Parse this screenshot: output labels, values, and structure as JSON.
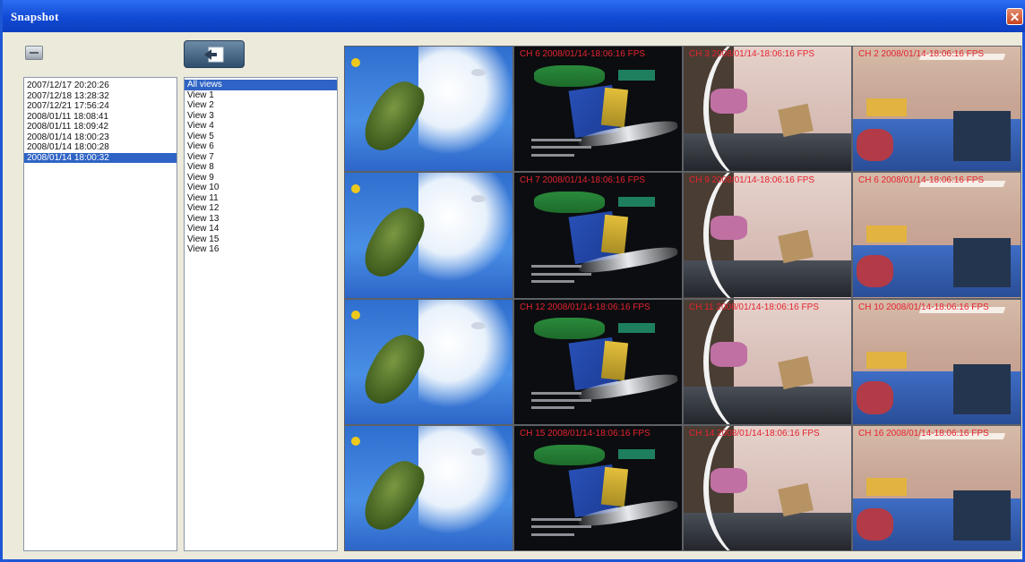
{
  "window": {
    "title": "Snapshot",
    "close_label": "✕"
  },
  "icons": {
    "minimize": "minus-icon",
    "export": "export-arrow-icon"
  },
  "colors": {
    "accent": "#2f63c5",
    "title_bar": "#1149d4",
    "overlay_text": "#e5232f"
  },
  "snapshot_list": {
    "items": [
      "2007/12/17 20:20:26",
      "2007/12/18 13:28:32",
      "2007/12/21 17:56:24",
      "2008/01/11 18:08:41",
      "2008/01/11 18:09:42",
      "2008/01/14 18:00:23",
      "2008/01/14 18:00:28",
      "2008/01/14 18:00:32"
    ],
    "selected": "2008/01/14 18:00:32"
  },
  "view_list": {
    "items": [
      "All views",
      "View 1",
      "View 2",
      "View 3",
      "View 4",
      "View 5",
      "View 6",
      "View 7",
      "View 8",
      "View 9",
      "View 10",
      "View 11",
      "View 12",
      "View 13",
      "View 14",
      "View 15",
      "View 16"
    ],
    "selected": "All views"
  },
  "grid": {
    "cells": [
      {
        "label": "",
        "scene": "map"
      },
      {
        "label": "CH 6 2008/01/14-18:06:16 FPS",
        "scene": "tv"
      },
      {
        "label": "CH 3 2008/01/14-18:06:16 FPS",
        "scene": "officeA"
      },
      {
        "label": "CH 2 2008/01/14-18:06:16 FPS",
        "scene": "officeB"
      },
      {
        "label": "",
        "scene": "map"
      },
      {
        "label": "CH 7 2008/01/14-18:06:16 FPS",
        "scene": "tv"
      },
      {
        "label": "CH 9 2008/01/14-18:06:16 FPS",
        "scene": "officeA"
      },
      {
        "label": "CH 6 2008/01/14-18:06:16 FPS",
        "scene": "officeB"
      },
      {
        "label": "",
        "scene": "map"
      },
      {
        "label": "CH 12 2008/01/14-18:06:16 FPS",
        "scene": "tv"
      },
      {
        "label": "CH 11 2008/01/14-18:06:16 FPS",
        "scene": "officeA"
      },
      {
        "label": "CH 10 2008/01/14-18:06:16 FPS",
        "scene": "officeB"
      },
      {
        "label": "",
        "scene": "map"
      },
      {
        "label": "CH 15 2008/01/14-18:06:16 FPS",
        "scene": "tv"
      },
      {
        "label": "CH 14 2008/01/14-18:06:16 FPS",
        "scene": "officeA"
      },
      {
        "label": "CH 16 2008/01/14-18:06:16 FPS",
        "scene": "officeB"
      }
    ]
  }
}
